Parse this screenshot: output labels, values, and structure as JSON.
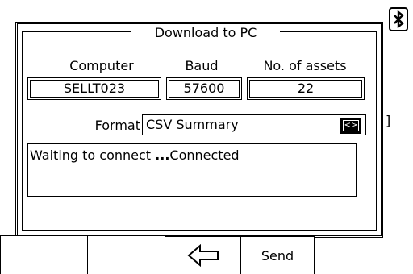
{
  "icons": {
    "bluetooth": "bluetooth-icon",
    "back": "back-arrow-icon"
  },
  "dialog": {
    "title": "Download to PC",
    "columns": {
      "computer": "Computer",
      "baud": "Baud",
      "assets": "No. of assets"
    },
    "values": {
      "computer": "SELLT023",
      "baud": "57600",
      "assets": "22"
    },
    "format": {
      "label": "Format",
      "value": "CSV Summary",
      "arrow": "<>"
    },
    "status": {
      "prefix": "Waiting to connect ",
      "dots": "...",
      "suffix": "Connected"
    }
  },
  "softkeys": {
    "back_symbol": "⇦",
    "send": "Send"
  },
  "background": {
    "right_bracket": "]"
  }
}
